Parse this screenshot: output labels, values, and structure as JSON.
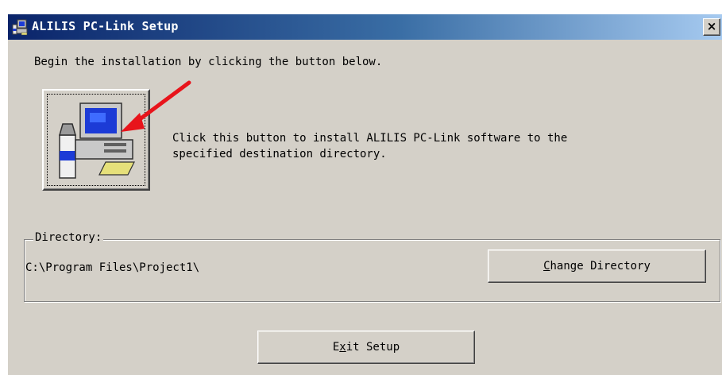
{
  "window": {
    "title": "ALILIS PC-Link Setup",
    "close_label": "×"
  },
  "main": {
    "instruction": "Begin the installation by clicking the button below.",
    "install_description_line1": "Click this button to install ALILIS PC-Link software to the",
    "install_description_line2": "specified destination directory."
  },
  "directory": {
    "label": "Directory:",
    "path": "C:\\Program Files\\Project1\\",
    "change_button": {
      "pre": "",
      "mnemonic": "C",
      "post": "hange Directory"
    }
  },
  "exit_button": {
    "pre": "E",
    "mnemonic": "x",
    "post": "it Setup"
  },
  "icons": {
    "title": "setup-computer-icon",
    "install": "computer-install-icon",
    "annotation": "red-arrow-icon"
  },
  "colors": {
    "titlebar_start": "#0a246a",
    "titlebar_end": "#a6caf0",
    "face": "#d4d0c8",
    "arrow": "#e8141b"
  }
}
